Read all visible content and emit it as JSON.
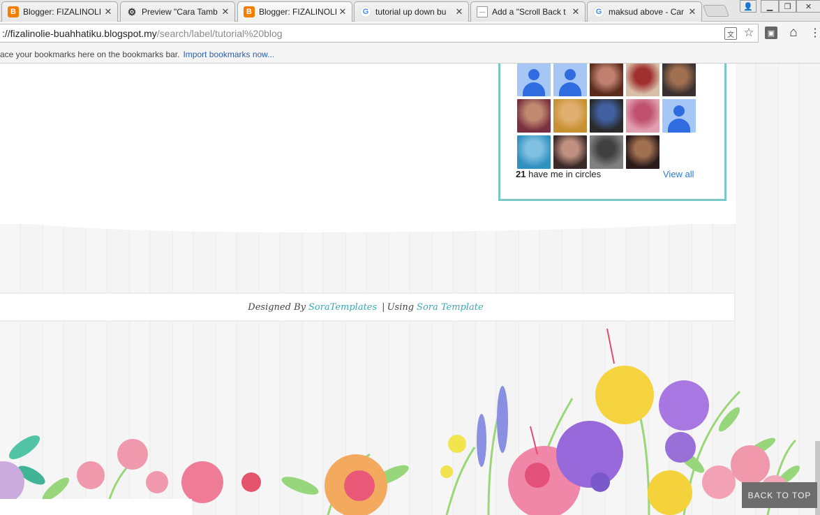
{
  "browser": {
    "tabs": [
      {
        "icon": "blogger-icon",
        "label": "Blogger: FIZALINOLI"
      },
      {
        "icon": "cog-icon",
        "label": "Preview \"Cara Tamb"
      },
      {
        "icon": "blogger-icon",
        "label": "Blogger: FIZALINOLI"
      },
      {
        "icon": "google-icon",
        "label": "tutorial up down bu"
      },
      {
        "icon": "page-icon",
        "label": "Add a \"Scroll Back t"
      },
      {
        "icon": "google-icon",
        "label": "maksud above - Car"
      }
    ],
    "url_host": "://fizalinolie-buahhatiku.blogspot.my",
    "url_path": "/search/label/tutorial%20blog",
    "bookmarks_text": "ace your bookmarks here on the bookmarks bar.",
    "bookmarks_link": "Import bookmarks now..."
  },
  "gplus": {
    "avatars": [
      "default",
      "default",
      "photo",
      "photo",
      "photo",
      "photo",
      "photo",
      "photo",
      "photo",
      "default",
      "photo",
      "photo",
      "photo",
      "photo"
    ],
    "count": "21",
    "count_suffix": "have me in circles",
    "view_all": "View all"
  },
  "footer": {
    "designed_by": "Designed By",
    "designer_link": "SoraTemplates",
    "separator": "|",
    "using": "Using",
    "template_link": "Sora Template"
  },
  "back_to_top": "BACK TO TOP",
  "colors": {
    "accent": "#79c7c6",
    "link": "#3aa9b3",
    "blogger": "#f57d00"
  }
}
